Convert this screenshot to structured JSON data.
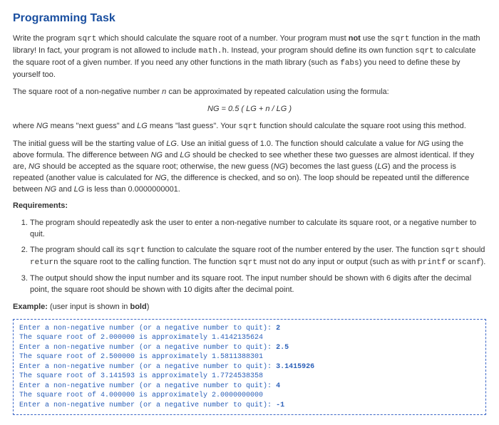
{
  "title": "Programming Task",
  "p1a": "Write the program ",
  "p1b": " which should calculate the square root of a number. Your program must ",
  "not": "not",
  "p1c": " use the ",
  "p1d": " function in the math library! In fact, your program is not allowed to include ",
  "mathh": "math.h",
  "p1e": ". Instead, your program should define its own function ",
  "p1f": " to calculate the square root of a given number. If you need any other functions in the math library (such as ",
  "fabs": "fabs",
  "p1g": ") you need to define these by yourself too.",
  "p2a": "The square root of a non-negative number ",
  "nvar": "n",
  "p2b": " can be approximated by repeated calculation using the formula:",
  "formula": "NG = 0.5 ( LG + n / LG )",
  "p3a": "where ",
  "ng": "NG",
  "p3b": " means \"next guess\" and ",
  "lg": "LG",
  "p3c": " means \"last guess\". Your ",
  "p3d": " function should calculate the square root using this method.",
  "p4a": "The initial guess will be the starting value of ",
  "p4b": ". Use an initial guess of 1.0. The function should calculate a value for ",
  "p4c": " using the above formula. The difference between ",
  "p4d": " and ",
  "p4e": " should be checked to see whether these two guesses are almost identical. If they are, ",
  "p4f": " should be accepted as the square root; otherwise, the new guess (",
  "p4g": ") becomes the last guess (",
  "p4h": ") and the process is repeated (another value is calculated for ",
  "p4i": ", the difference is checked, and so on). The loop should be repeated until the difference between ",
  "p4j": " is less than 0.0000000001.",
  "reqs": "Requirements:",
  "r1": "The program should repeatedly ask the user to enter a non-negative number to calculate its square root, or a negative number to quit.",
  "r2a": "The program should call its ",
  "r2b": " function to calculate the square root of the number entered by the user. The function ",
  "r2c": " should ",
  "return": "return",
  "r2d": " the square root to the calling function. The function ",
  "r2e": " must not do any input or output (such as with ",
  "printf": "printf",
  "or": " or ",
  "scanf": "scanf",
  "r2f": ").",
  "r3": "The output should show the input number and its square root. The input number should be shown with 6 digits after the decimal point, the square root should be shown with 10 digits after the decimal point.",
  "example": "Example:",
  "exnote": " (user input is shown in ",
  "bold": "bold",
  "exnote2": ")",
  "sqrt": "sqrt",
  "prompt": "Enter a non-negative number (or a negative number to quit): ",
  "out1": "The square root of 2.000000 is approximately 1.4142135624",
  "out2": "The square root of 2.500000 is approximately 1.5811388301",
  "out3": "The square root of 3.141593 is approximately 1.7724538358",
  "out4": "The square root of 4.000000 is approximately 2.0000000000",
  "in1": "2",
  "in2": "2.5",
  "in3": "3.1415926",
  "in4": "4",
  "in5": "-1"
}
